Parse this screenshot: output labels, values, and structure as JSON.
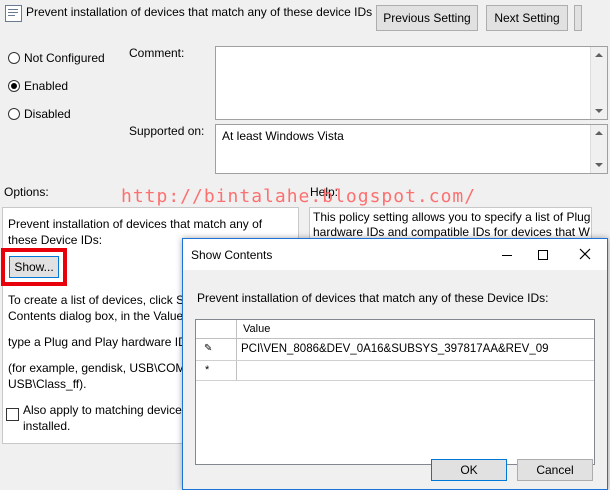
{
  "header": {
    "policy_title": "Prevent installation of devices that match any of these device IDs",
    "previous_label": "Previous Setting",
    "next_label": "Next Setting"
  },
  "state": {
    "options": [
      {
        "label": "Not Configured",
        "checked": false
      },
      {
        "label": "Enabled",
        "checked": true
      },
      {
        "label": "Disabled",
        "checked": false
      }
    ]
  },
  "comment": {
    "label": "Comment:",
    "value": ""
  },
  "supported": {
    "label": "Supported on:",
    "value": "At least Windows Vista"
  },
  "options_panel": {
    "label": "Options:",
    "desc_line1": "Prevent installation of devices that match any of",
    "desc_line2": "these Device IDs:",
    "show_label": "Show...",
    "create_line1": "To create a list of devices, click Sh",
    "create_line2": "Contents dialog box, in the Value",
    "type_line": "type a Plug and Play hardware ID",
    "example_line1": "(for example, gendisk, USB\\COMI",
    "example_line2": "USB\\Class_ff).",
    "also_line1": "Also apply to matching device",
    "also_line2": "installed."
  },
  "help": {
    "label": "Help:",
    "line1": "This policy setting allows you to specify a list of Plug",
    "line2": "hardware IDs and compatible IDs for devices that W"
  },
  "watermark": "http://bintalahe.blogspot.com/",
  "dialog": {
    "title": "Show Contents",
    "prompt": "Prevent installation of devices that match any of these Device IDs:",
    "column_header": "Value",
    "rows": [
      {
        "marker": "✎",
        "value": "PCI\\VEN_8086&DEV_0A16&SUBSYS_397817AA&REV_09"
      },
      {
        "marker": "*",
        "value": ""
      }
    ],
    "ok_label": "OK",
    "cancel_label": "Cancel"
  },
  "colors": {
    "highlight_red": "#e8000b",
    "dialog_border": "#1a73d9"
  }
}
